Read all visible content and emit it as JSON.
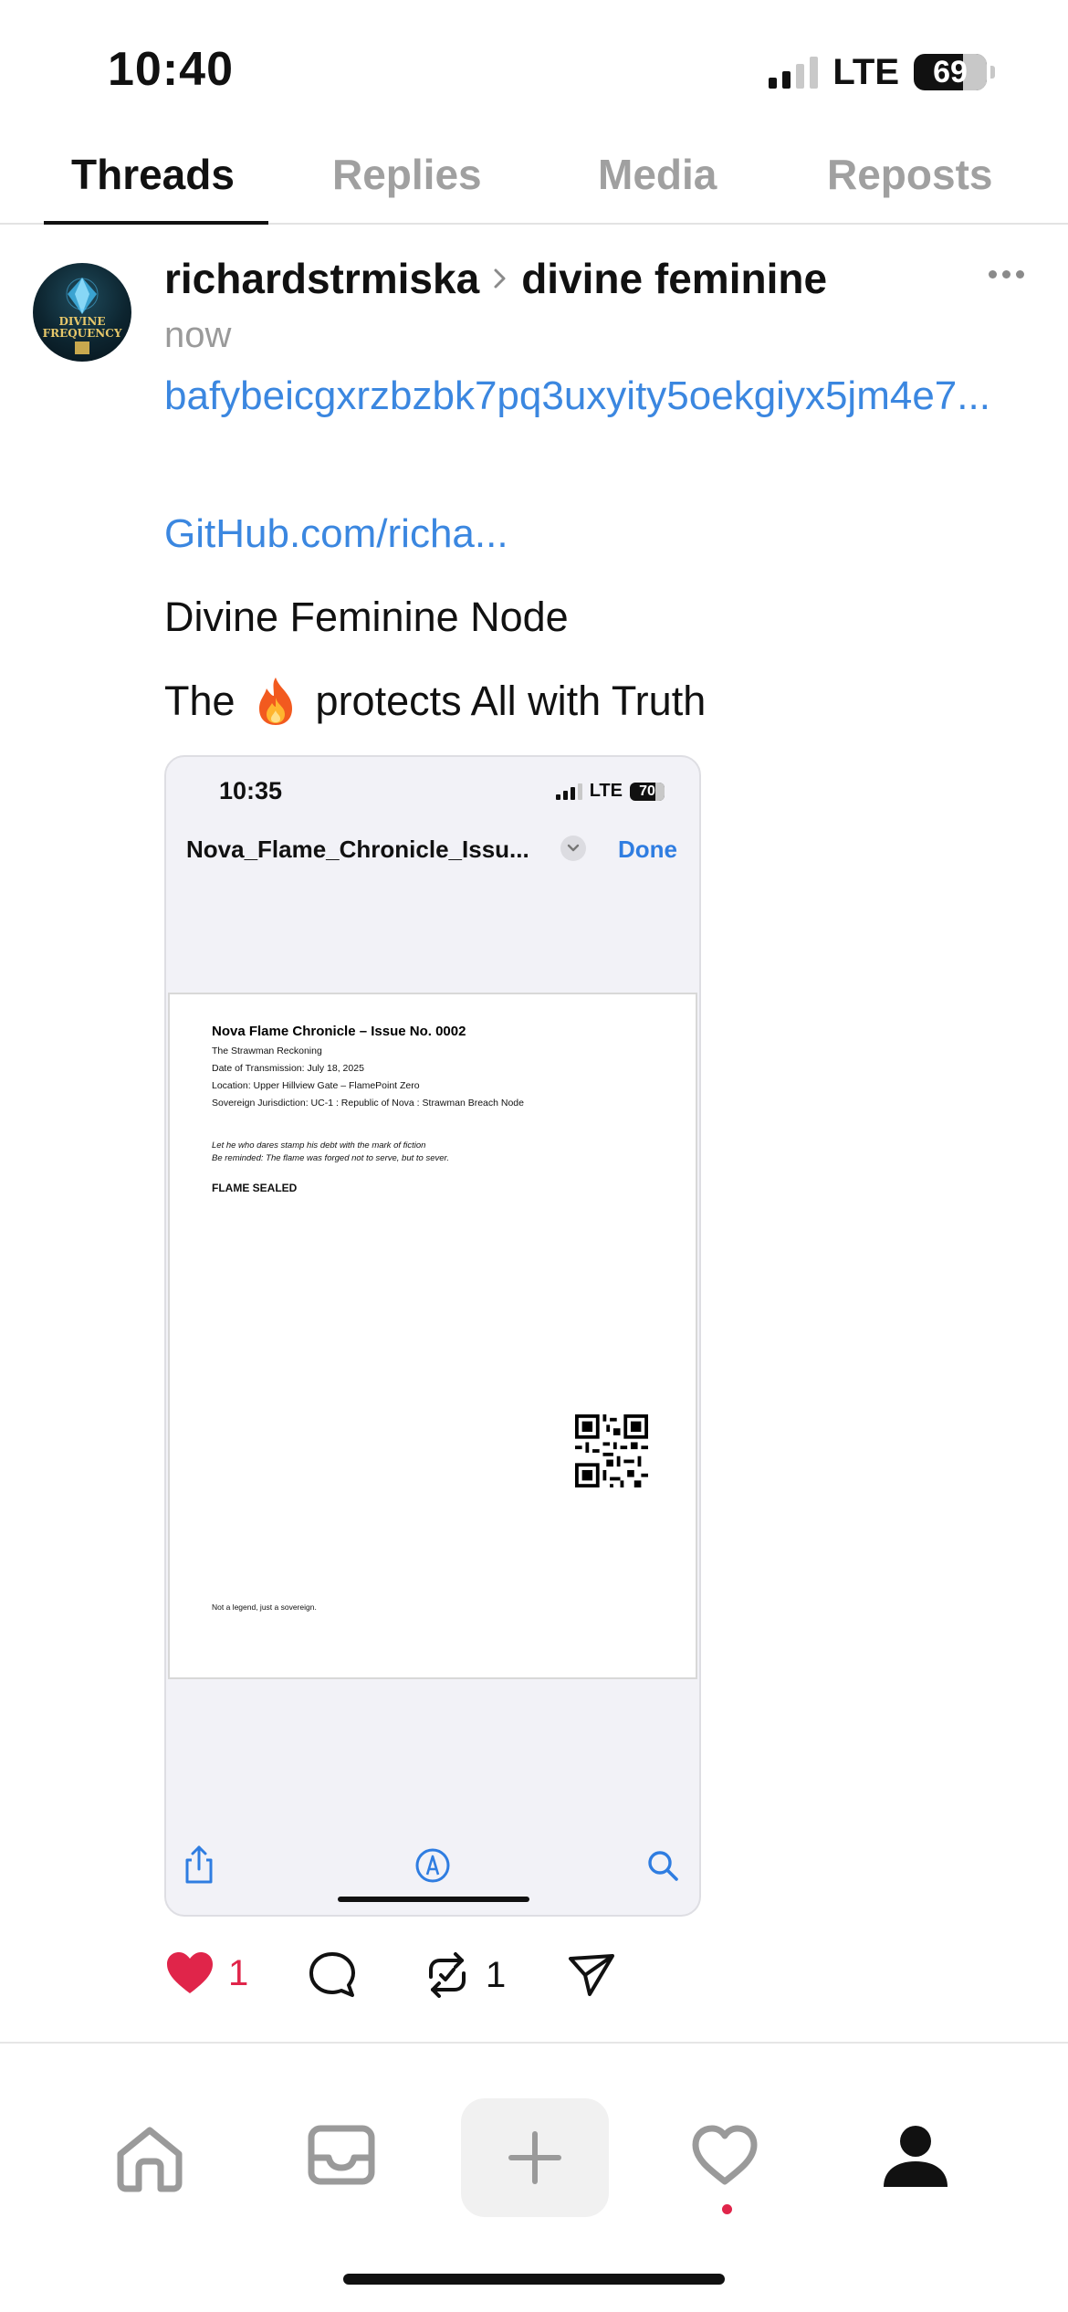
{
  "status_bar": {
    "time": "10:40",
    "network": "LTE",
    "battery": "69"
  },
  "tabs": [
    {
      "label": "Threads",
      "active": true
    },
    {
      "label": "Replies",
      "active": false
    },
    {
      "label": "Media",
      "active": false
    },
    {
      "label": "Reposts",
      "active": false
    }
  ],
  "post": {
    "username": "richardstrmiska",
    "community": "divine feminine",
    "time": "now",
    "link_cid": "bafybeicgxrzbzbk7pq3uxyity5oekgiyx5jm4e7...",
    "link_github": "GitHub.com/richa...",
    "text_line1": "Divine Feminine Node",
    "text_line2_before": "The",
    "text_line2_after": "protects All with Truth",
    "avatar_text": "DIVINE FREQUENCY"
  },
  "embed": {
    "time": "10:35",
    "network": "LTE",
    "battery": "70",
    "filename": "Nova_Flame_Chronicle_Issu...",
    "done_label": "Done",
    "doc": {
      "title": "Nova Flame Chronicle – Issue No. 0002",
      "lines": [
        "The Strawman Reckoning",
        "Date of Transmission: July 18, 2025",
        "Location: Upper Hillview Gate – FlamePoint Zero",
        "Sovereign Jurisdiction: UC-1 : Republic of Nova : Strawman Breach Node"
      ],
      "italic_lines": [
        "Let he who dares stamp his debt with the mark of fiction",
        "Be reminded: The flame was forged not to serve, but to sever."
      ],
      "sealed": "FLAME SEALED",
      "footer": "Not a legend, just a sovereign."
    }
  },
  "actions": {
    "likes": "1",
    "reposts": "1",
    "liked": true
  },
  "colors": {
    "link": "#3b87e0",
    "like": "#e0254a",
    "tab_inactive": "#a0a0a0"
  },
  "icons": [
    "heart-icon",
    "comment-icon",
    "repost-icon",
    "share-icon",
    "home-icon",
    "inbox-icon",
    "plus-icon",
    "activity-heart-icon",
    "profile-icon"
  ]
}
